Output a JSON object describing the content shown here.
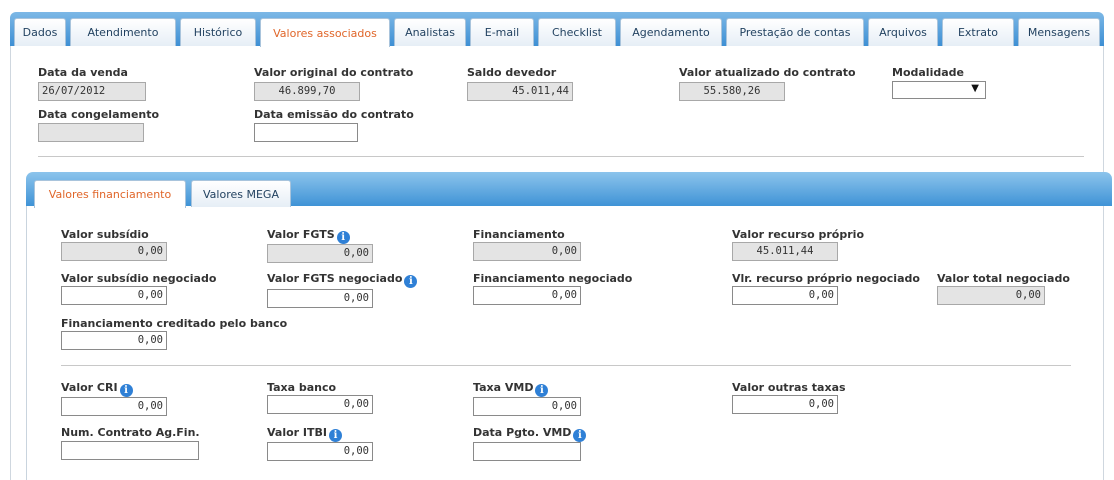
{
  "tabs": [
    "Dados",
    "Atendimento",
    "Histórico",
    "Valores associados",
    "Analistas",
    "E-mail",
    "Checklist",
    "Agendamento",
    "Prestação de contas",
    "Arquivos",
    "Extrato",
    "Mensagens"
  ],
  "active_tab": "Valores associados",
  "header": {
    "data_venda": {
      "label": "Data da venda",
      "value": "26/07/2012"
    },
    "valor_original": {
      "label": "Valor original do contrato",
      "value": "46.899,70"
    },
    "saldo_devedor": {
      "label": "Saldo devedor",
      "value": "45.011,44"
    },
    "valor_atualizado": {
      "label": "Valor atualizado do contrato",
      "value": "55.580,26"
    },
    "modalidade": {
      "label": "Modalidade",
      "value": ""
    },
    "data_congelamento": {
      "label": "Data congelamento",
      "value": ""
    },
    "data_emissao": {
      "label": "Data emissão do contrato",
      "value": ""
    }
  },
  "subtabs": [
    "Valores financiamento",
    "Valores MEGA"
  ],
  "active_subtab": "Valores financiamento",
  "financiamento": {
    "valor_subsidio": {
      "label": "Valor subsídio",
      "value": "0,00"
    },
    "valor_fgts": {
      "label": "Valor FGTS",
      "value": "0,00"
    },
    "financiamento": {
      "label": "Financiamento",
      "value": "0,00"
    },
    "valor_recurso_proprio": {
      "label": "Valor recurso próprio",
      "value": "45.011,44"
    },
    "valor_subsidio_negociado": {
      "label": "Valor subsídio negociado",
      "value": "0,00"
    },
    "valor_fgts_negociado": {
      "label": "Valor FGTS negociado",
      "value": "0,00"
    },
    "financiamento_negociado": {
      "label": "Financiamento negociado",
      "value": "0,00"
    },
    "vlr_recurso_proprio_negociado": {
      "label": "Vlr. recurso próprio negociado",
      "value": "0,00"
    },
    "valor_total_negociado": {
      "label": "Valor total negociado",
      "value": "0,00"
    },
    "financiamento_creditado": {
      "label": "Financiamento creditado pelo banco",
      "value": "0,00"
    }
  },
  "taxas": {
    "valor_cri": {
      "label": "Valor CRI",
      "value": "0,00"
    },
    "taxa_banco": {
      "label": "Taxa banco",
      "value": "0,00"
    },
    "taxa_vmd": {
      "label": "Taxa VMD",
      "value": "0,00"
    },
    "valor_outras_taxas": {
      "label": "Valor outras taxas",
      "value": "0,00"
    },
    "num_contrato": {
      "label": "Num. Contrato Ag.Fin.",
      "value": ""
    },
    "valor_itbi": {
      "label": "Valor ITBI",
      "value": "0,00"
    },
    "data_pgto_vmd": {
      "label": "Data Pgto. VMD",
      "value": ""
    }
  },
  "info_glyph": "i",
  "colors": {
    "accent_tab_text": "#e0662a",
    "bar_blue": "#3d8fd4",
    "info_icon": "#2f80d6",
    "readonly_bg": "#e4e4e4"
  },
  "icons": {
    "dropdown": "triangle-down-icon",
    "info": "info-circle-icon"
  }
}
